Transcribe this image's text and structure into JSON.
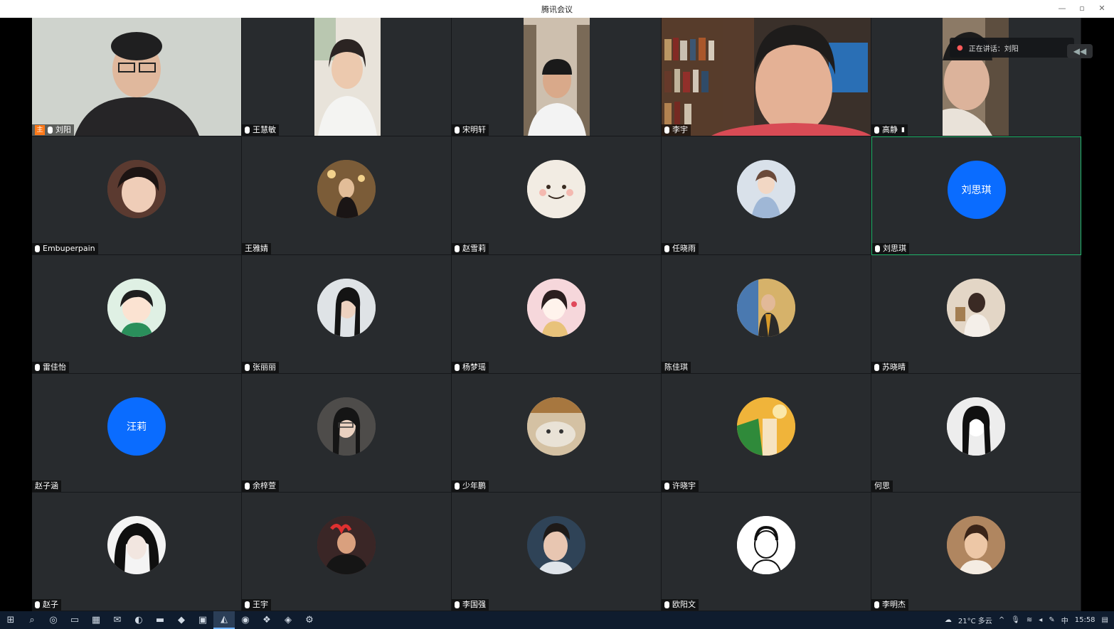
{
  "window": {
    "title": "腾讯会议",
    "controls": [
      "—",
      "▫",
      "✕"
    ]
  },
  "participants": [
    {
      "name": "刘阳",
      "kind": "video",
      "host": true,
      "host_label": "主"
    },
    {
      "name": "王慧敏",
      "kind": "video"
    },
    {
      "name": "宋明轩",
      "kind": "video"
    },
    {
      "name": "李宇",
      "kind": "video"
    },
    {
      "name": "高静",
      "kind": "video"
    },
    {
      "name": "Embuperpain",
      "kind": "avatar",
      "color": "#6b4a3e"
    },
    {
      "name": "王雅婧",
      "kind": "avatar",
      "color": "#8a6b43"
    },
    {
      "name": "赵雪莉",
      "kind": "avatar",
      "color": "#efe6d6"
    },
    {
      "name": "任晓雨",
      "kind": "avatar",
      "color": "#c9d4e0"
    },
    {
      "name": "刘思琪",
      "kind": "text",
      "text": "刘思琪",
      "active": true
    },
    {
      "name": "雷佳怡",
      "kind": "avatar",
      "color": "#cfe7d8"
    },
    {
      "name": "张丽丽",
      "kind": "avatar",
      "color": "#d7d9dc"
    },
    {
      "name": "杨梦瑶",
      "kind": "avatar",
      "color": "#f0c9cf"
    },
    {
      "name": "陈佳琪",
      "kind": "avatar",
      "color": "#c8a25a"
    },
    {
      "name": "苏晓晴",
      "kind": "avatar",
      "color": "#d8c7b3"
    },
    {
      "name": "赵子涵",
      "kind": "text",
      "text": "汪莉"
    },
    {
      "name": "余梓萱",
      "kind": "avatar",
      "color": "#5c5a58"
    },
    {
      "name": "少年鹏",
      "kind": "avatar",
      "color": "#c9b69a"
    },
    {
      "name": "许晓宇",
      "kind": "avatar",
      "color": "#e9a42a"
    },
    {
      "name": "何思",
      "kind": "avatar",
      "color": "#e3e3e3"
    },
    {
      "name": "赵子",
      "kind": "avatar",
      "color": "#111111"
    },
    {
      "name": "王宇",
      "kind": "avatar",
      "color": "#7a1f1f"
    },
    {
      "name": "李国强",
      "kind": "avatar",
      "color": "#2c3b4a"
    },
    {
      "name": "欧阳文",
      "kind": "avatar",
      "color": "#ffffff"
    },
    {
      "name": "李明杰",
      "kind": "avatar",
      "color": "#a57a56"
    }
  ],
  "speaker_pip": {
    "label": "正在讲话：刘阳"
  },
  "collapse_label": "◀◀",
  "taskbar": {
    "icons": [
      "windows-start",
      "search",
      "task-view",
      "widgets",
      "store",
      "mail",
      "edge",
      "explorer",
      "app1",
      "app2",
      "meeting",
      "chat",
      "wechat",
      "qq",
      "settings"
    ],
    "weather": "21°C 多云",
    "ime": "中",
    "time": "15:58"
  }
}
